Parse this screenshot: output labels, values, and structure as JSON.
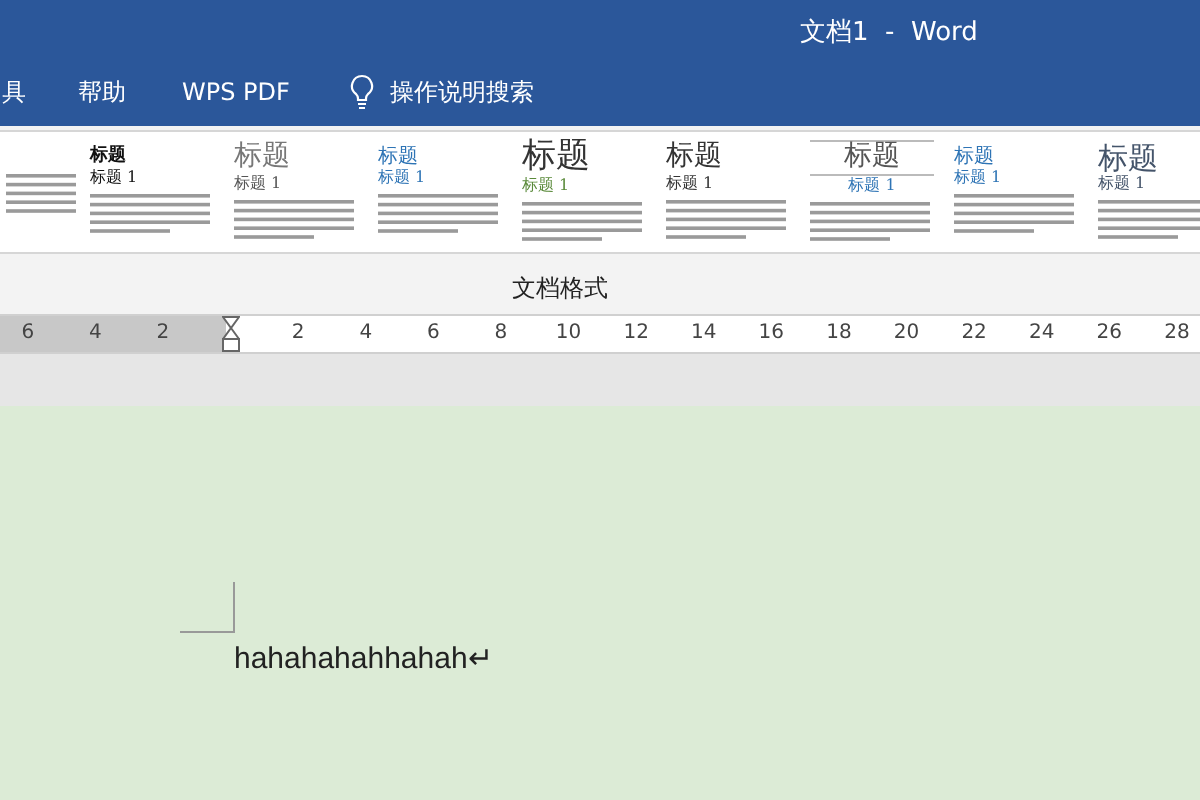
{
  "window": {
    "title": "文档1  -  Word"
  },
  "ribbon_tabs": [
    {
      "label": "具"
    },
    {
      "label": "帮助"
    },
    {
      "label": "WPS PDF"
    }
  ],
  "tell_me": {
    "label": "操作说明搜索"
  },
  "style_gallery": {
    "items": [
      {
        "kind": "cut"
      },
      {
        "kind": "bold",
        "title": "标题",
        "heading": "标题 1"
      },
      {
        "kind": "light",
        "title": "标题",
        "heading": "标题 1"
      },
      {
        "kind": "blue",
        "title": "标题",
        "heading": "标题 1"
      },
      {
        "kind": "large",
        "title": "标题",
        "heading": "标题 1"
      },
      {
        "kind": "classic",
        "title": "标题",
        "heading": "标题 1"
      },
      {
        "kind": "centered",
        "title": "标题",
        "heading": "标题 1"
      },
      {
        "kind": "accent",
        "title": "标题",
        "heading": "标题 1"
      },
      {
        "kind": "slate",
        "title": "标题",
        "heading": "标题 1"
      }
    ],
    "group_label": "文档格式"
  },
  "ruler": {
    "left_labels": [
      "6",
      "4",
      "2"
    ],
    "right_labels": [
      "2",
      "4",
      "6",
      "8",
      "10",
      "12",
      "14",
      "16",
      "18",
      "20",
      "22",
      "24",
      "26",
      "28"
    ]
  },
  "document": {
    "text": "hahahahahhahah↵"
  }
}
